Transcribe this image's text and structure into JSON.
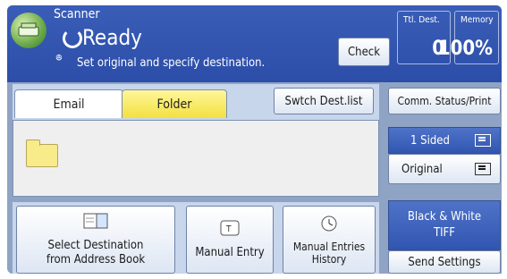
{
  "header": {
    "mode": "Scanner",
    "status": "Ready",
    "message": "Set original and specify destination.",
    "check_label": "Check",
    "ttl_dest_label": "Ttl. Dest.",
    "ttl_dest_value": "0",
    "memory_label": "Memory",
    "memory_value": "100%"
  },
  "tabs": [
    {
      "label": "Email",
      "selected": false
    },
    {
      "label": "Folder",
      "selected": true
    }
  ],
  "switch_dest_label": "Swtch Dest.list",
  "buttons": {
    "select_destination": [
      "Select Destination",
      "from Address Book"
    ],
    "manual_entry": "Manual Entry",
    "manual_history": [
      "Manual Entries",
      "History"
    ]
  },
  "sidebar": {
    "comm_status": "Comm. Status/Print",
    "sided": "1 Sided",
    "original": "Original",
    "color_mode": [
      "Black & White",
      "TIFF"
    ],
    "send_settings": "Send Settings"
  }
}
